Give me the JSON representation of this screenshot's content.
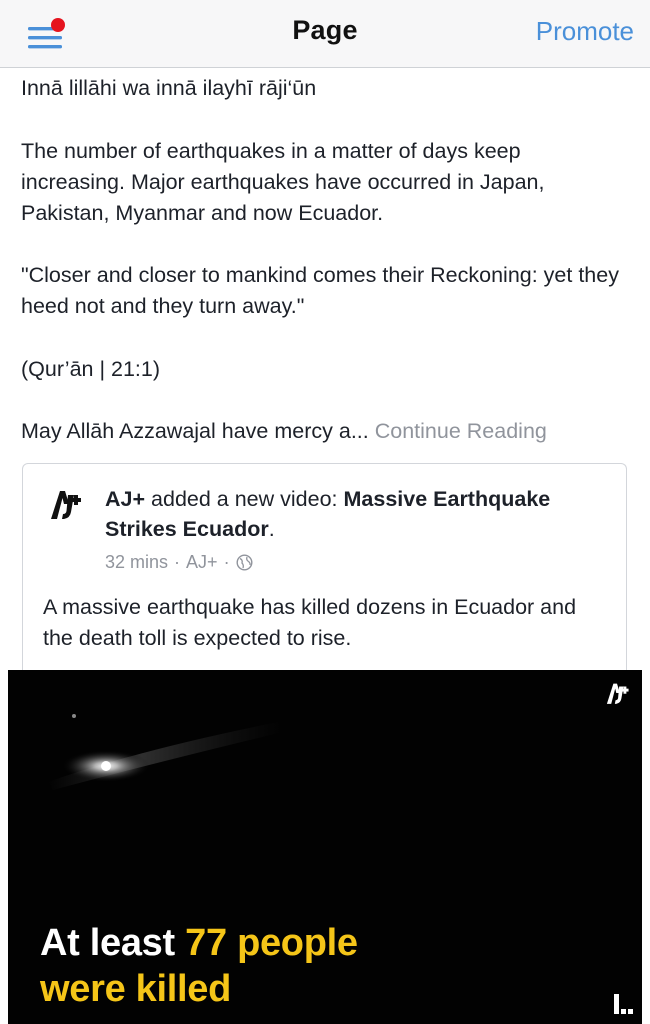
{
  "navbar": {
    "title": "Page",
    "promote_label": "Promote",
    "menu_icon": "hamburger-menu-icon",
    "notification_color": "#e5141f"
  },
  "post": {
    "line_1": "Innā lillāhi wa innā ilayhī rāji‘ūn",
    "paragraph_2": "The number of earthquakes in a matter of days keep increasing. Major earthquakes have occurred in Japan, Pakistan, Myanmar and now Ecuador.",
    "quote": "\"Closer and closer to mankind comes their Reckoning: yet they heed not and they turn away.\"",
    "reference": "(Qur’ān | 21:1)",
    "truncated_text": "May Allāh Azzawajal have mercy a...",
    "continue_label": "Continue Reading"
  },
  "shared_post": {
    "author": "AJ+",
    "action": "added a new video:",
    "video_title": "Massive Earthquake Strikes Ecuador",
    "title_suffix": ".",
    "time": "32 mins",
    "separator": "·",
    "page_name": "AJ+",
    "privacy_icon": "globe-icon",
    "description": "A massive earthquake has killed dozens in Ecuador and the death toll is expected to rise."
  },
  "video": {
    "caption_part_1": "At least ",
    "caption_highlight_1": "77 people",
    "caption_highlight_2": "were killed",
    "highlight_color": "#f5c518",
    "logo_icon": "aj-plus-logo-icon",
    "corner_icon": "stats-icon"
  },
  "colors": {
    "link_blue": "#4a90d9",
    "meta_gray": "#90949c",
    "text": "#1d2129"
  }
}
